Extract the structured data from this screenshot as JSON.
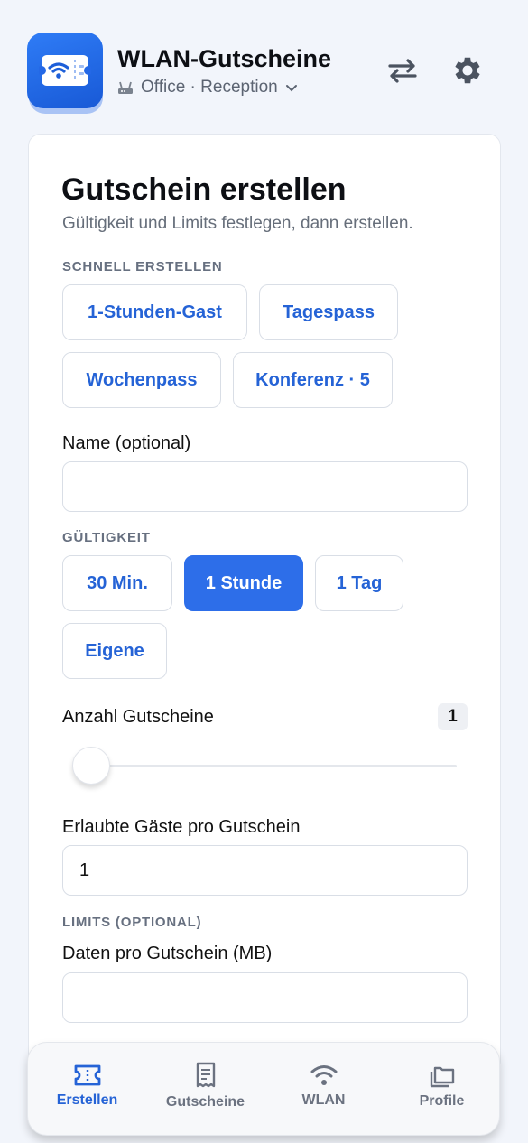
{
  "header": {
    "title": "WLAN-Gutscheine",
    "subtitle": "Office · Reception",
    "icons": {
      "app": "wifi-ticket-icon",
      "router": "router-icon",
      "chevron": "chevron-down-icon",
      "swap": "swap-arrows-icon",
      "settings": "gear-icon"
    }
  },
  "card": {
    "title": "Gutschein erstellen",
    "subtitle": "Gültigkeit und Limits festlegen, dann erstellen.",
    "quick": {
      "label": "SCHNELL ERSTELLEN",
      "presets": [
        "1-Stunden-Gast",
        "Tagespass",
        "Wochenpass",
        "Konferenz · 5"
      ]
    },
    "name": {
      "label": "Name (optional)",
      "value": "",
      "placeholder": ""
    },
    "validity": {
      "label": "GÜLTIGKEIT",
      "options": [
        "30 Min.",
        "1 Stunde",
        "1 Tag",
        "Eigene"
      ],
      "selected": "1 Stunde"
    },
    "count": {
      "label": "Anzahl Gutscheine",
      "value": "1",
      "slider_fraction": 0
    },
    "guests": {
      "label": "Erlaubte Gäste pro Gutschein",
      "value": "1"
    },
    "limits": {
      "label": "LIMITS (OPTIONAL)",
      "data": {
        "label": "Daten pro Gutschein (MB)",
        "value": ""
      }
    }
  },
  "nav": {
    "items": [
      {
        "label": "Erstellen",
        "icon": "ticket-icon",
        "active": true
      },
      {
        "label": "Gutscheine",
        "icon": "receipt-icon",
        "active": false
      },
      {
        "label": "WLAN",
        "icon": "wifi-icon",
        "active": false
      },
      {
        "label": "Profile",
        "icon": "folders-icon",
        "active": false
      }
    ]
  },
  "colors": {
    "accent": "#2d6ee9",
    "link": "#2563d6",
    "muted": "#6b7280"
  }
}
